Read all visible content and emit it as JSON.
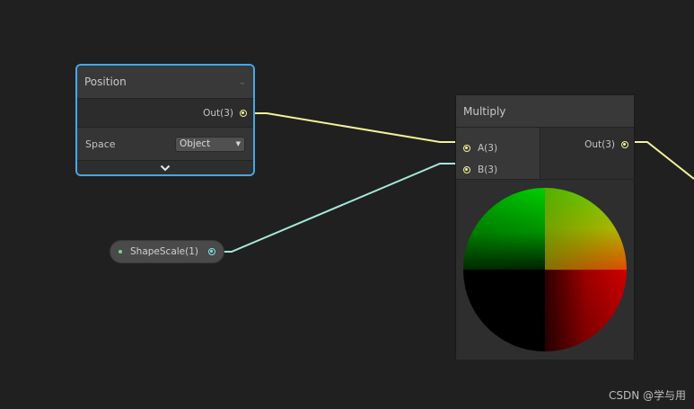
{
  "position_node": {
    "title": "Position",
    "output_label": "Out(3)",
    "space_label": "Space",
    "space_value": "Object"
  },
  "property_node": {
    "label": "ShapeScale(1)"
  },
  "multiply_node": {
    "title": "Multiply",
    "input_a_label": "A(3)",
    "input_b_label": "B(3)",
    "output_label": "Out(3)"
  },
  "watermark": "CSDN @学与用",
  "colors": {
    "background": "#202020",
    "selection_outline": "#44a8e8",
    "vector3_wire": "#f2f29a",
    "vector1_wire": "#84e4e7"
  },
  "icons": {
    "collapse": "chevron-down-icon",
    "expand": "chevron-down-icon",
    "dropdown": "caret-down-icon"
  }
}
